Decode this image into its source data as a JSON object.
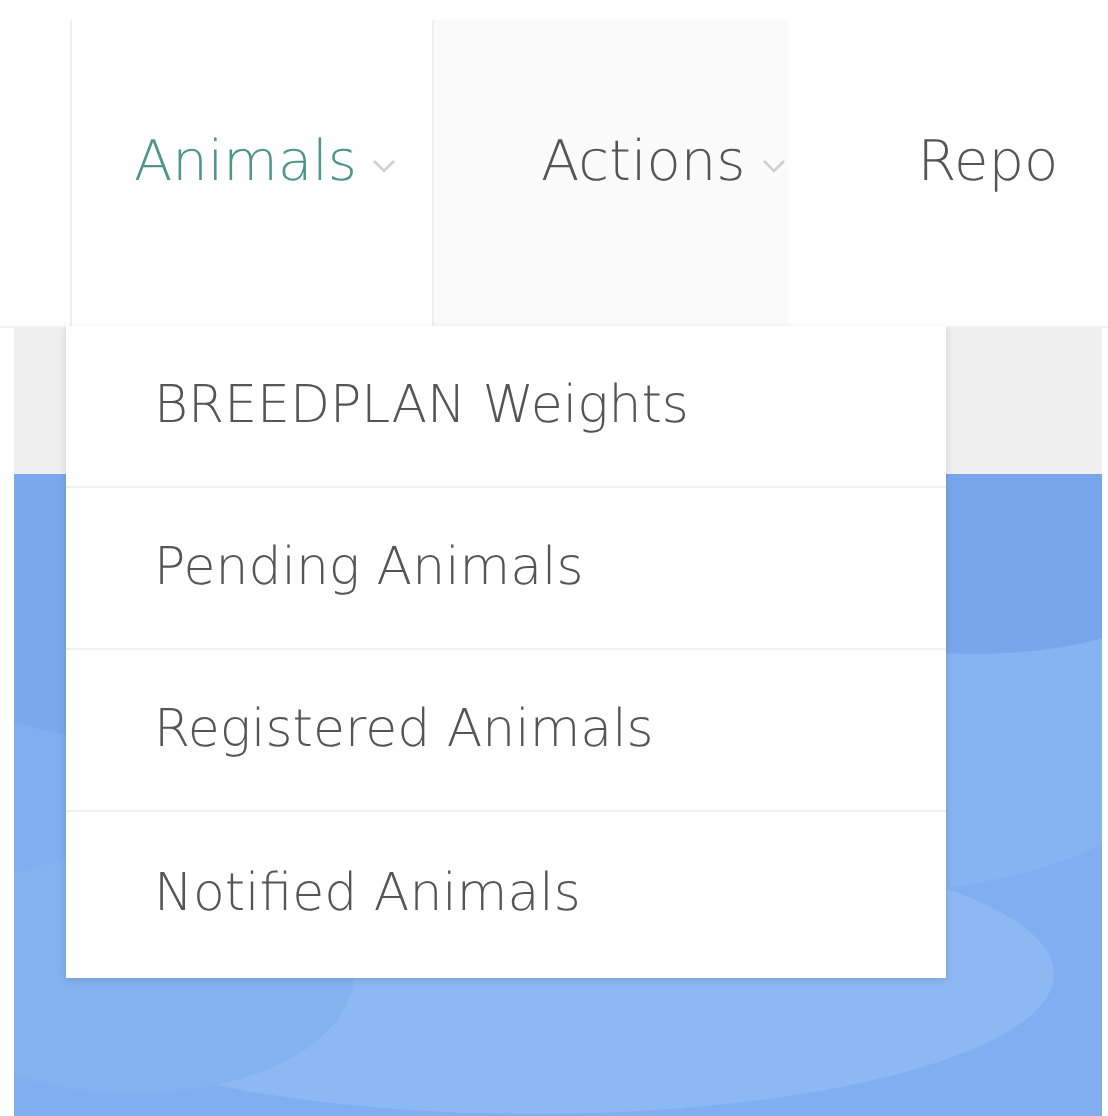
{
  "nav": {
    "tabs": [
      {
        "label": "Animals",
        "selected": true,
        "dropdown": true
      },
      {
        "label": "Actions",
        "selected": false,
        "dropdown": true
      },
      {
        "label": "Repo",
        "selected": false,
        "dropdown": false
      }
    ]
  },
  "dropdown_menu": {
    "items": [
      {
        "label": "BREEDPLAN Weights"
      },
      {
        "label": "Pending Animals"
      },
      {
        "label": "Registered Animals"
      },
      {
        "label": "Notified Animals"
      }
    ]
  }
}
